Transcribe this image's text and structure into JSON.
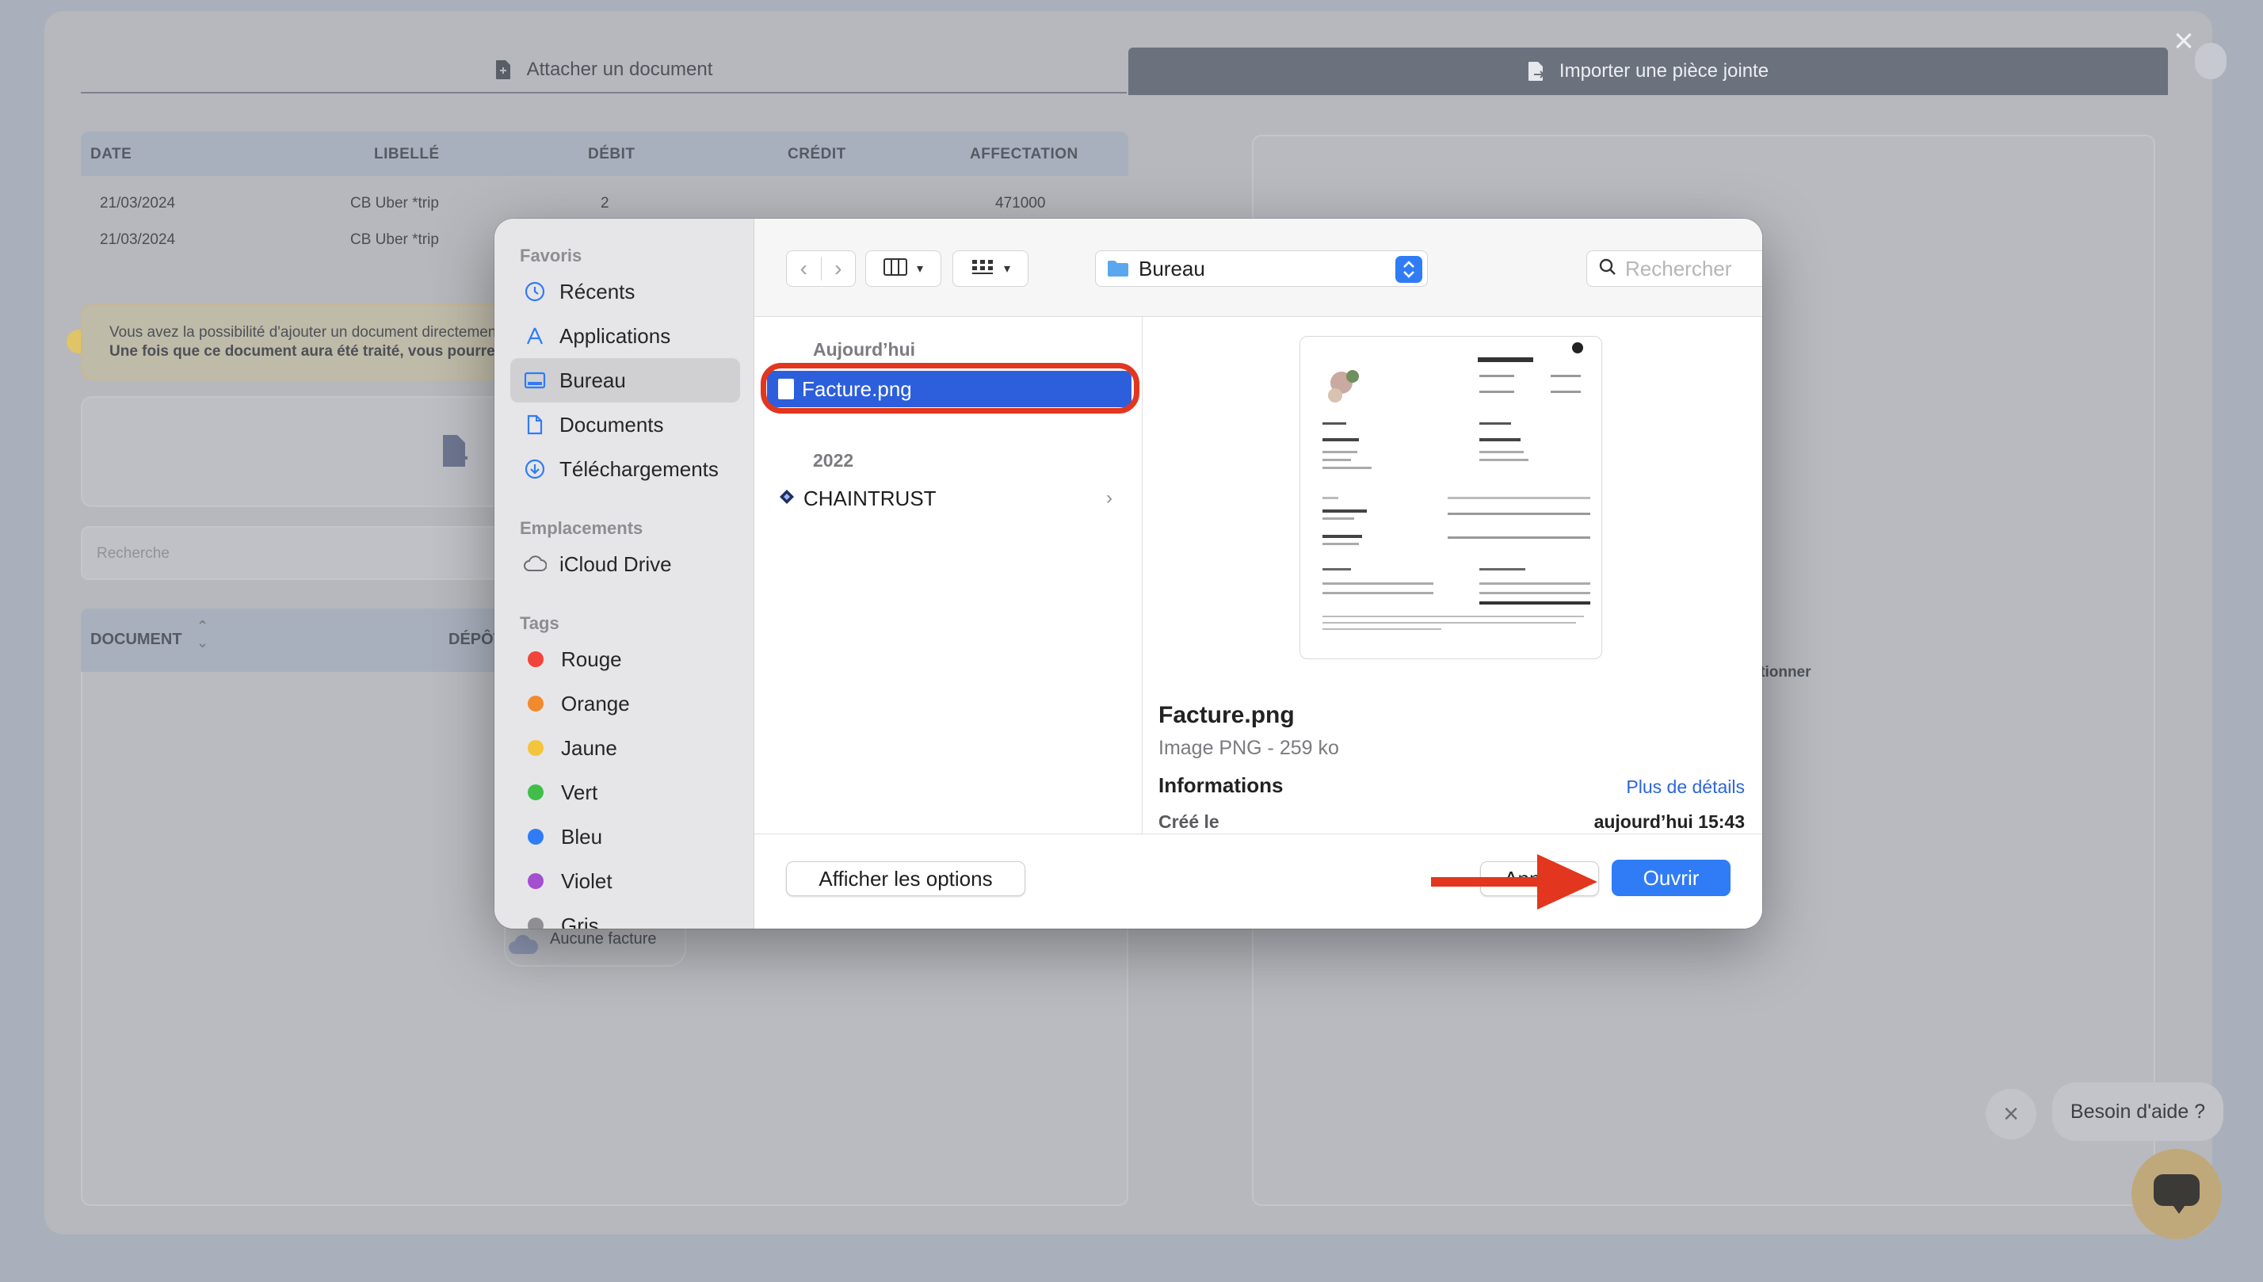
{
  "app": {
    "tabs": [
      {
        "label": "Attacher un document"
      },
      {
        "label": "Importer une pièce jointe"
      }
    ],
    "transactions": {
      "headers": [
        "DATE",
        "LIBELLÉ",
        "DÉBIT",
        "CRÉDIT",
        "AFFECTATION"
      ],
      "rows": [
        {
          "date": "21/03/2024",
          "label": "CB Uber *trip",
          "debit": "2",
          "credit": "",
          "affectation": "471000"
        },
        {
          "date": "21/03/2024",
          "label": "CB Uber *trip",
          "debit": "",
          "credit": "",
          "affectation": ""
        }
      ]
    },
    "info": {
      "line1": "Vous avez la possibilité d'ajouter un document directement",
      "line2": "Une fois que ce document aura été traité, vous pourrez"
    },
    "search_placeholder": "Recherche",
    "documents": {
      "col_document": "DOCUMENT",
      "col_depot": "DÉPÔT"
    },
    "right_hint": "ectionner",
    "no_invoice_label": "Aucune facture"
  },
  "help": {
    "bubble_text": "Besoin d'aide ?"
  },
  "dialog": {
    "sidebar": {
      "favorites_title": "Favoris",
      "favorites": [
        {
          "label": "Récents",
          "icon": "clock-icon"
        },
        {
          "label": "Applications",
          "icon": "applications-icon"
        },
        {
          "label": "Bureau",
          "icon": "desktop-icon",
          "selected": true
        },
        {
          "label": "Documents",
          "icon": "document-icon"
        },
        {
          "label": "Téléchargements",
          "icon": "download-icon"
        }
      ],
      "locations_title": "Emplacements",
      "locations": [
        {
          "label": "iCloud Drive",
          "icon": "cloud-icon"
        }
      ],
      "tags_title": "Tags",
      "tags": [
        {
          "label": "Rouge",
          "color": "#f1443a"
        },
        {
          "label": "Orange",
          "color": "#f28a2d"
        },
        {
          "label": "Jaune",
          "color": "#f4c43a"
        },
        {
          "label": "Vert",
          "color": "#3fbf48"
        },
        {
          "label": "Bleu",
          "color": "#2f7cf6"
        },
        {
          "label": "Violet",
          "color": "#a34fd0"
        },
        {
          "label": "Gris",
          "color": "#8e8e93"
        }
      ]
    },
    "toolbar": {
      "location": "Bureau",
      "search_placeholder": "Rechercher"
    },
    "files": {
      "group_today": "Aujourd’hui",
      "today_items": [
        {
          "name": "Facture.png",
          "selected": true
        }
      ],
      "group_2022": "2022",
      "items_2022": [
        {
          "name": "CHAINTRUST"
        }
      ]
    },
    "preview": {
      "name": "Facture.png",
      "kind": "Image PNG - 259 ko",
      "info_title": "Informations",
      "more_link": "Plus de détails",
      "created_label": "Créé le",
      "created_value": "aujourd’hui 15:43"
    },
    "footer": {
      "options_label": "Afficher les options",
      "cancel_label": "Annuler",
      "open_label": "Ouvrir"
    }
  },
  "colors": {
    "accent": "#2f7cf6",
    "selection": "#2d5fdc",
    "annotation": "#e2361e"
  }
}
